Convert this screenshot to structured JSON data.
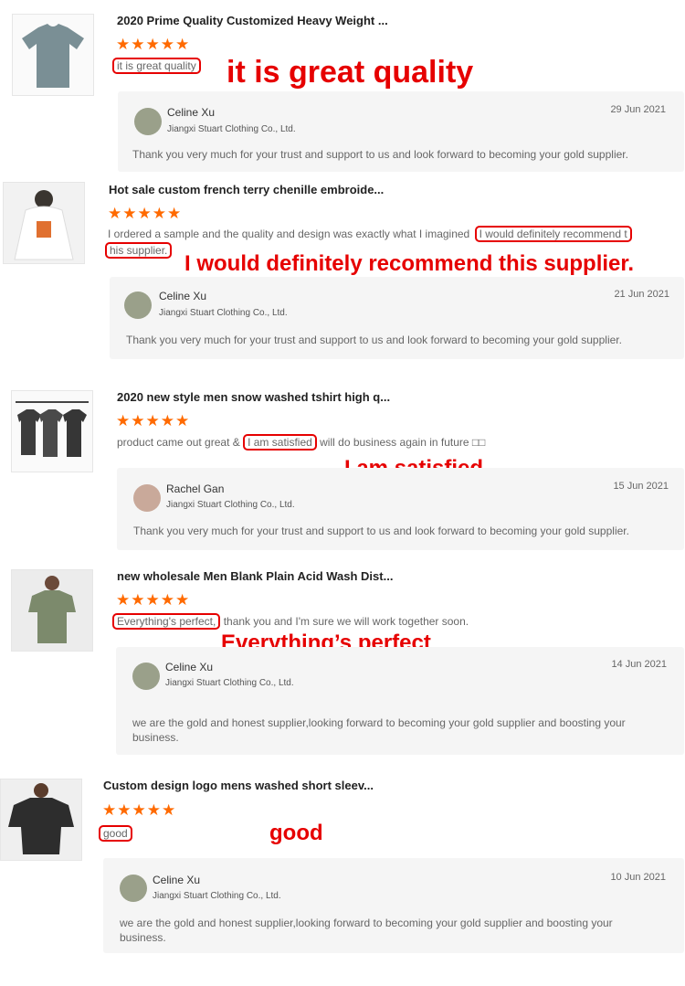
{
  "reviews": [
    {
      "title": "2020 Prime Quality Customized Heavy Weight ...",
      "stars": "★★★★★",
      "text_highlight": "it is great quality",
      "callout": "it is great quality",
      "reply": {
        "name": "Celine Xu",
        "company": "Jiangxi Stuart Clothing Co., Ltd.",
        "date": "29 Jun 2021",
        "text": "Thank you very much for your trust and support to us and look forward to becoming your gold supplier."
      }
    },
    {
      "title": "Hot sale custom french terry chenille embroide...",
      "stars": "★★★★★",
      "text_before": "I ordered a sample and the quality and design was exactly what I imagined",
      "text_highlight_1": "I would definitely recommend t",
      "text_highlight_2": "his supplier.",
      "callout": "I would definitely recommend this supplier.",
      "reply": {
        "name": "Celine Xu",
        "company": "Jiangxi Stuart Clothing Co., Ltd.",
        "date": "21 Jun 2021",
        "text": "Thank you very much for your trust and support to us and look forward to becoming your gold supplier."
      }
    },
    {
      "title": "2020 new style men snow washed tshirt high q...",
      "stars": "★★★★★",
      "text_before": "product came out great &",
      "text_highlight": "I am satisfied",
      "text_after": "will do business again in future □□",
      "callout": "I am satisfied",
      "reply": {
        "name": "Rachel Gan",
        "company": "Jiangxi Stuart Clothing Co., Ltd.",
        "date": "15 Jun 2021",
        "text": "Thank you very much for your trust and support to us and look forward to becoming your gold supplier."
      }
    },
    {
      "title": "new wholesale Men Blank Plain Acid Wash Dist...",
      "stars": "★★★★★",
      "text_highlight": "Everything's perfect,",
      "text_after": "thank you and I'm sure we will work together soon.",
      "callout": "Everything’s perfect",
      "reply": {
        "name": "Celine Xu",
        "company": "Jiangxi Stuart Clothing Co., Ltd.",
        "date": "14 Jun 2021",
        "text_line1": "we are the gold and honest supplier,looking forward to becoming your gold supplier and boosting your",
        "text_line2": "business."
      }
    },
    {
      "title": "Custom design logo mens washed short sleev...",
      "stars": "★★★★★",
      "text_highlight": "good",
      "callout": "good",
      "reply": {
        "name": "Celine Xu",
        "company": "Jiangxi Stuart Clothing Co., Ltd.",
        "date": "10 Jun 2021",
        "text_line1": "we are the gold and honest supplier,looking forward to becoming your gold supplier and boosting your",
        "text_line2": "business."
      }
    }
  ],
  "colors": {
    "accent": "#ff6a00",
    "callout": "#e60000",
    "reply_bg": "#f5f5f5"
  },
  "icons": [
    "tshirt-product-image",
    "hoodie-product-image",
    "avatar-icon"
  ]
}
